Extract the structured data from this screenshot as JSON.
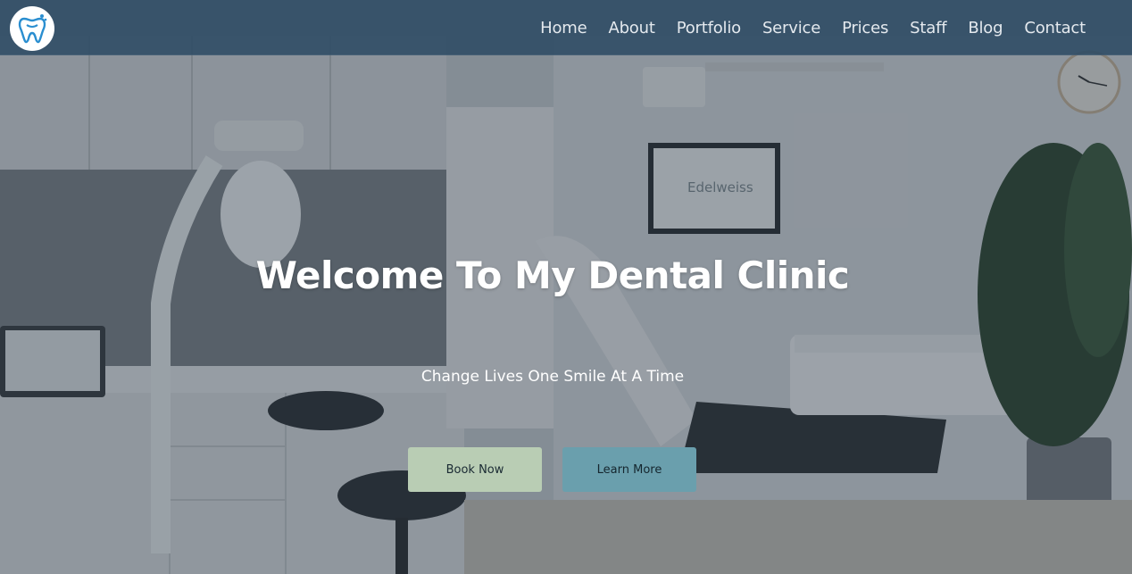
{
  "nav": {
    "logo_icon": "tooth-logo-icon",
    "items": [
      {
        "label": "Home"
      },
      {
        "label": "About"
      },
      {
        "label": "Portfolio"
      },
      {
        "label": "Service"
      },
      {
        "label": "Prices"
      },
      {
        "label": "Staff"
      },
      {
        "label": "Blog"
      },
      {
        "label": "Contact"
      }
    ]
  },
  "hero": {
    "title": "Welcome To My Dental Clinic",
    "subtitle": "Change Lives One Smile At A Time",
    "book_label": "Book Now",
    "learn_label": "Learn More",
    "tv_brand": "Edelweiss"
  },
  "colors": {
    "navbar": "#2d4b64",
    "book_button": "#b9cdb4",
    "learn_button": "#6a9fad",
    "text": "#ffffff"
  }
}
